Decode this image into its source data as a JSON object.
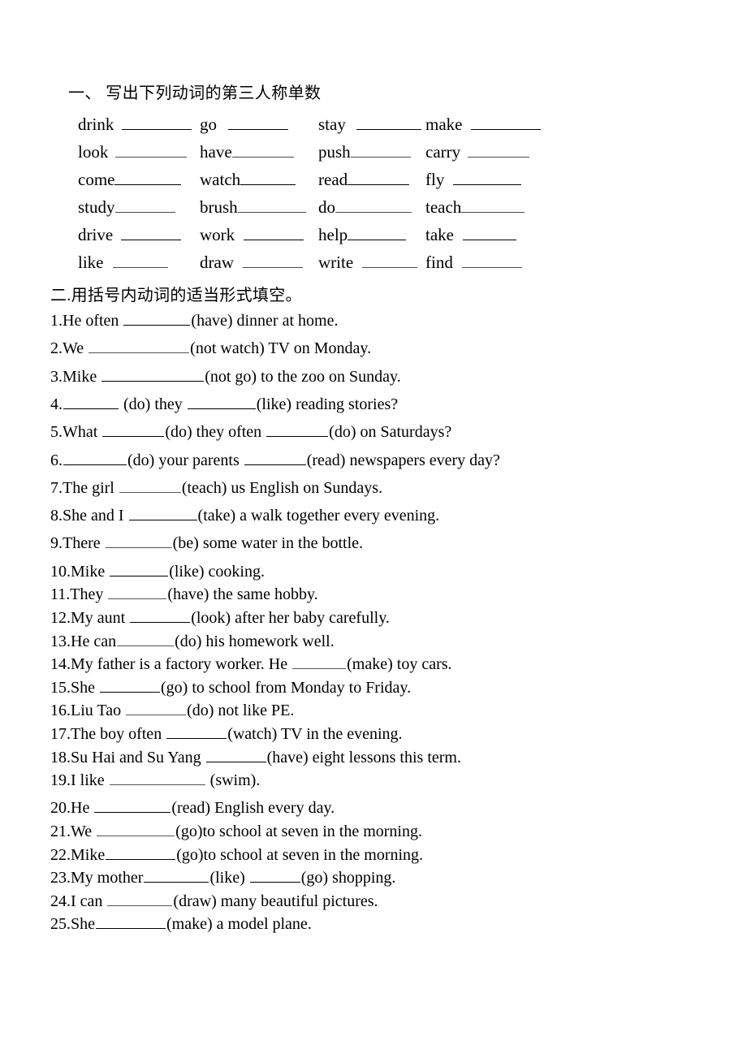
{
  "document": {
    "type": "worksheet",
    "language": "zh-CN/en",
    "background_color": "#ffffff",
    "text_color": "#000000"
  },
  "section1": {
    "heading": "一、 写出下列动词的第三人称单数",
    "rows": [
      [
        {
          "word": "drink",
          "gap_before": 10,
          "blank_width": 86,
          "blank_style": "bold"
        },
        {
          "word": "go",
          "gap_before": 14,
          "blank_width": 74,
          "blank_style": "bold"
        },
        {
          "word": "stay",
          "gap_before": 13,
          "blank_width": 80,
          "blank_style": "bold"
        },
        {
          "word": "make",
          "gap_before": 11,
          "blank_width": 86,
          "blank_style": "bold"
        }
      ],
      [
        {
          "word": "look",
          "gap_before": 9,
          "blank_width": 88,
          "blank_style": "thin"
        },
        {
          "word": "have",
          "gap_before": 0,
          "blank_width": 76,
          "blank_style": "thin"
        },
        {
          "word": "push",
          "gap_before": 0,
          "blank_width": 74,
          "blank_style": "thin"
        },
        {
          "word": "carry",
          "gap_before": 9,
          "blank_width": 76,
          "blank_style": "thin"
        }
      ],
      [
        {
          "word": "come",
          "gap_before": 0,
          "blank_width": 82,
          "blank_style": "bold"
        },
        {
          "word": "watch",
          "gap_before": 0,
          "blank_width": 68,
          "blank_style": "bold"
        },
        {
          "word": "read",
          "gap_before": 0,
          "blank_width": 76,
          "blank_style": "bold"
        },
        {
          "word": "fly",
          "gap_before": 11,
          "blank_width": 84,
          "blank_style": "bold"
        }
      ],
      [
        {
          "word": "study",
          "gap_before": 0,
          "blank_width": 74,
          "blank_style": "thin"
        },
        {
          "word": "brush",
          "gap_before": 0,
          "blank_width": 84,
          "blank_style": "thin"
        },
        {
          "word": "do",
          "gap_before": 0,
          "blank_width": 94,
          "blank_style": "thin"
        },
        {
          "word": "teach",
          "gap_before": 0,
          "blank_width": 78,
          "blank_style": "thin"
        }
      ],
      [
        {
          "word": "drive",
          "gap_before": 10,
          "blank_width": 74,
          "blank_style": "bold"
        },
        {
          "word": "work",
          "gap_before": 11,
          "blank_width": 74,
          "blank_style": "bold"
        },
        {
          "word": "help",
          "gap_before": 0,
          "blank_width": 72,
          "blank_style": "bold"
        },
        {
          "word": "take",
          "gap_before": 11,
          "blank_width": 66,
          "blank_style": "bold"
        }
      ],
      [
        {
          "word": "like",
          "gap_before": 11,
          "blank_width": 68,
          "blank_style": "thin"
        },
        {
          "word": "draw",
          "gap_before": 11,
          "blank_width": 74,
          "blank_style": "thin"
        },
        {
          "word": "write",
          "gap_before": 11,
          "blank_width": 68,
          "blank_style": "thin"
        },
        {
          "word": "find",
          "gap_before": 11,
          "blank_width": 74,
          "blank_style": "thin"
        }
      ]
    ],
    "column_offsets": [
      0,
      150,
      296,
      428
    ]
  },
  "section2": {
    "heading": "二.用括号内动词的适当形式填空。",
    "questions": [
      {
        "number": "1.",
        "parts": [
          {
            "t": "He often "
          },
          {
            "b": 82
          },
          {
            "t": "(have) dinner at home."
          }
        ],
        "spacing": "loose"
      },
      {
        "number": "2.",
        "parts": [
          {
            "t": "We "
          },
          {
            "b": 124,
            "thin": true
          },
          {
            "t": "(not watch) TV on Monday."
          }
        ],
        "spacing": "loose"
      },
      {
        "number": "3.",
        "parts": [
          {
            "t": "Mike "
          },
          {
            "b": 126
          },
          {
            "t": "(not go) to the zoo on Sunday."
          }
        ],
        "spacing": "loose"
      },
      {
        "number": "4.",
        "parts": [
          {
            "b": 68
          },
          {
            "t": " (do) they "
          },
          {
            "b": 84
          },
          {
            "t": "(like) reading stories?"
          }
        ],
        "spacing": "loose"
      },
      {
        "number": "5.",
        "parts": [
          {
            "t": "What "
          },
          {
            "b": 76
          },
          {
            "t": "(do) they often "
          },
          {
            "b": 76
          },
          {
            "t": "(do) on Saturdays?"
          }
        ],
        "spacing": "loose"
      },
      {
        "number": "6.",
        "parts": [
          {
            "b": 78
          },
          {
            "t": "(do) your parents "
          },
          {
            "b": 76
          },
          {
            "t": "(read) newspapers every day?"
          }
        ],
        "spacing": "loose"
      },
      {
        "number": "7.",
        "parts": [
          {
            "t": "The girl "
          },
          {
            "b": 76,
            "thin": true
          },
          {
            "t": "(teach) us English on Sundays."
          }
        ],
        "spacing": "loose"
      },
      {
        "number": "8.",
        "parts": [
          {
            "t": "She and I "
          },
          {
            "b": 84
          },
          {
            "t": "(take) a walk together every evening."
          }
        ],
        "spacing": "loose"
      },
      {
        "number": "9.",
        "parts": [
          {
            "t": "There "
          },
          {
            "b": 82,
            "thin": true
          },
          {
            "t": "(be) some water in the bottle."
          }
        ],
        "spacing": "loose"
      },
      {
        "number": "10.",
        "parts": [
          {
            "t": "Mike "
          },
          {
            "b": 72
          },
          {
            "t": "(like) cooking."
          }
        ],
        "spacing": "tight"
      },
      {
        "number": "11.",
        "parts": [
          {
            "t": "They "
          },
          {
            "b": 72,
            "thin": true
          },
          {
            "t": "(have) the same hobby."
          }
        ],
        "spacing": "tight"
      },
      {
        "number": "12.",
        "parts": [
          {
            "t": "My aunt "
          },
          {
            "b": 74
          },
          {
            "t": "(look) after her baby carefully."
          }
        ],
        "spacing": "tight"
      },
      {
        "number": "13.",
        "parts": [
          {
            "t": "He can"
          },
          {
            "b": 70,
            "thin": true
          },
          {
            "t": "(do) his homework well."
          }
        ],
        "spacing": "tight"
      },
      {
        "number": "14.",
        "parts": [
          {
            "t": "My father is a factory worker. He "
          },
          {
            "b": 66,
            "thin": true
          },
          {
            "t": "(make) toy cars."
          }
        ],
        "spacing": "tight"
      },
      {
        "number": "15.",
        "parts": [
          {
            "t": "She "
          },
          {
            "b": 74
          },
          {
            "t": "(go) to school from Monday to Friday."
          }
        ],
        "spacing": "tight"
      },
      {
        "number": "16.",
        "parts": [
          {
            "t": "Liu Tao "
          },
          {
            "b": 74,
            "thin": true
          },
          {
            "t": "(do) not like PE."
          }
        ],
        "spacing": "tight"
      },
      {
        "number": "17.",
        "parts": [
          {
            "t": "The boy often "
          },
          {
            "b": 74
          },
          {
            "t": "(watch) TV in the evening."
          }
        ],
        "spacing": "tight"
      },
      {
        "number": "18.",
        "parts": [
          {
            "t": "Su Hai and Su Yang "
          },
          {
            "b": 74
          },
          {
            "t": "(have) eight lessons this term."
          }
        ],
        "spacing": "tight"
      },
      {
        "number": "19.",
        "parts": [
          {
            "t": "I like "
          },
          {
            "b": 118,
            "thin": true
          },
          {
            "t": " (swim)."
          }
        ],
        "spacing": "loose"
      },
      {
        "number": "20.",
        "parts": [
          {
            "t": "He "
          },
          {
            "b": 94
          },
          {
            "t": "(read) English every day."
          }
        ],
        "spacing": "tight"
      },
      {
        "number": "21.",
        "parts": [
          {
            "t": "We "
          },
          {
            "b": 96,
            "thin": true
          },
          {
            "t": "(go)to school at seven in the morning."
          }
        ],
        "spacing": "tight"
      },
      {
        "number": "22.",
        "parts": [
          {
            "t": "Mike"
          },
          {
            "b": 86
          },
          {
            "t": "(go)to school at seven in the morning."
          }
        ],
        "spacing": "tight"
      },
      {
        "number": "23.",
        "parts": [
          {
            "t": "My mother"
          },
          {
            "b": 80
          },
          {
            "t": "(like) "
          },
          {
            "b": 62
          },
          {
            "t": "(go) shopping."
          }
        ],
        "spacing": "tight"
      },
      {
        "number": "24.",
        "parts": [
          {
            "t": "I can "
          },
          {
            "b": 80,
            "thin": true
          },
          {
            "t": "(draw) many beautiful pictures."
          }
        ],
        "spacing": "tight"
      },
      {
        "number": "25.",
        "parts": [
          {
            "t": "She"
          },
          {
            "b": 86
          },
          {
            "t": "(make) a model plane."
          }
        ],
        "spacing": "tight"
      }
    ]
  }
}
